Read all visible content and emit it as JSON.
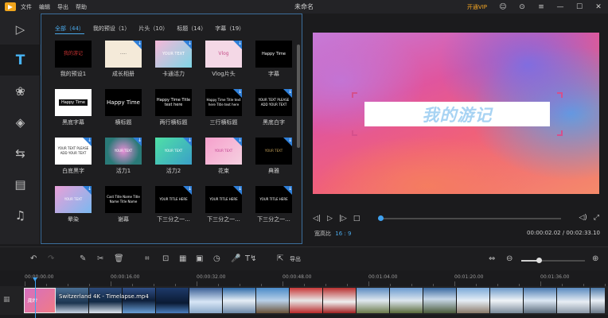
{
  "titlebar": {
    "menu": [
      "文件",
      "编辑",
      "导出",
      "帮助"
    ],
    "title": "未命名",
    "vip": "开通VIP",
    "icons": [
      "user-icon",
      "feedback-icon",
      "menu-icon",
      "minimize-icon",
      "maximize-icon",
      "close-icon"
    ]
  },
  "rail": [
    "media-icon",
    "text-icon",
    "filter-icon",
    "overlay-icon",
    "transition-icon",
    "element-icon",
    "music-icon"
  ],
  "library": {
    "tabs": [
      "全部（44）",
      "我的预设（1）",
      "片头（10）",
      "标题（14）",
      "字幕（19）"
    ],
    "items": [
      {
        "label": "我的预设1",
        "thumb": "我的游记"
      },
      {
        "label": "成长相册",
        "thumb": "·····"
      },
      {
        "label": "卡通活力",
        "thumb": "YOUR TEXT"
      },
      {
        "label": "Vlog片头",
        "thumb": "Vlog"
      },
      {
        "label": "字幕",
        "thumb": "Happy Time"
      },
      {
        "label": "黑底字幕",
        "thumb": "Happy Time"
      },
      {
        "label": "横标题",
        "thumb": "Happy Time"
      },
      {
        "label": "两行横标题",
        "thumb": "Happy Time Title text here"
      },
      {
        "label": "三行横标题",
        "thumb": "Happy Time Title text here Title text here"
      },
      {
        "label": "黑底白字",
        "thumb": "YOUR TEXT PLEASE ADD YOUR TEXT"
      },
      {
        "label": "白底黑字",
        "thumb": "YOUR TEXT PLEASE ADD YOUR TEXT"
      },
      {
        "label": "活力1",
        "thumb": "YOUR TEXT"
      },
      {
        "label": "活力2",
        "thumb": "YOUR TEXT"
      },
      {
        "label": "花束",
        "thumb": "YOUR TEXT"
      },
      {
        "label": "典雅",
        "thumb": "YOUR TEXT"
      },
      {
        "label": "晕染",
        "thumb": "YOUR TEXT"
      },
      {
        "label": "谢幕",
        "thumb": "Cast Title Name Title Name Title Name"
      },
      {
        "label": "下三分之一...",
        "thumb": "YOUR TITLE HERE"
      },
      {
        "label": "下三分之一...",
        "thumb": "YOUR TITLE HERE"
      },
      {
        "label": "下三分之一...",
        "thumb": "YOUR TITLE HERE"
      }
    ]
  },
  "preview": {
    "caption": "我的游记",
    "ratio_label": "宽高比",
    "ratio_value": "16 : 9",
    "timecode": "00:00:02.02 / 00:02:33.10",
    "progress": 0.01
  },
  "toolbar": {
    "export_label": "导出",
    "zoom_level": 0.28
  },
  "timeline": {
    "ticks": [
      "00:00:00.00",
      "00:00:16.00",
      "00:00:32.00",
      "00:00:48.00",
      "00:01:04.00",
      "00:01:20.00",
      "00:01:36.00"
    ],
    "clip1_label": "我的",
    "clip2_title": "Switzerland 4K - Timelapse.mp4"
  },
  "colors": {
    "accent": "#4aa8e8",
    "vip": "#f5a623",
    "panel_border": "#3c6e9c"
  }
}
